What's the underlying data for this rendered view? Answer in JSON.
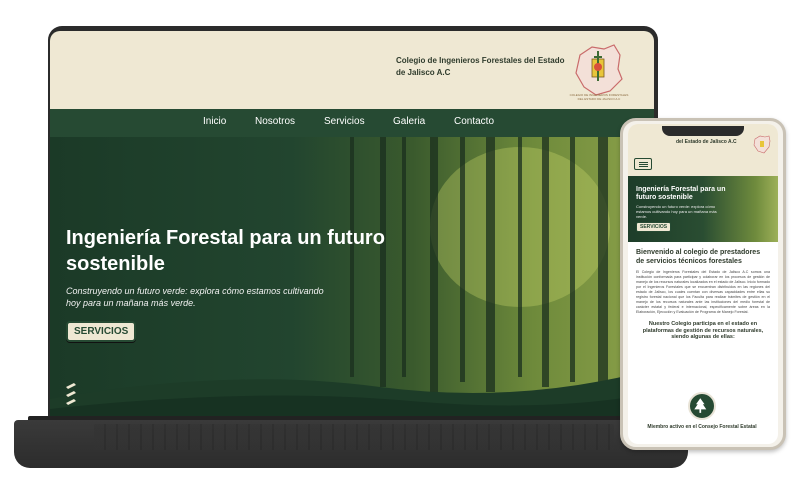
{
  "site": {
    "org_name": "Colegio de Ingenieros Forestales del Estado de Jalisco A.C",
    "logo_caption": "COLEGIO DE INGENIEROS FORESTALES DEL ESTADO DE JALISCO A.C"
  },
  "nav": {
    "items": [
      "Inicio",
      "Nosotros",
      "Servicios",
      "Galeria",
      "Contacto"
    ]
  },
  "hero": {
    "title": "Ingeniería Forestal para un futuro sostenible",
    "subtitle": "Construyendo un futuro verde: explora cómo estamos cultivando hoy para un mañana más verde.",
    "button": "SERVICIOS"
  },
  "mobile": {
    "header_title": "del Estado de Jalisco A.C",
    "welcome": "Bienvenido al colegio de prestadores de servicios técnicos forestales",
    "paragraph": "El Colegio de Ingenieros Forestales del Estado de Jalisco A.C somos una institución conformada para participar y colaborar en los procesos de gestión de manejo de los recursos naturales localizados en el estado de Jalisco. Inicio formado por el Ingenieros Forestales que se encuentran distribuidos en las regiones del estado de Jalisco, los cuales cuentan con diversas capacidades entre ellas su registro forestal nacional que los Faculta para realizar trámites de gestión en el manejo de los recursos naturales ante las instituciones del medio forestal de carácter estatal y federal e internacional, específicamente sobre áreas en la Elaboración, Ejecución y Evaluación de Programa de Manejo Forestal.",
    "highlight": "Nuestro Colegio participa en el estado en plataformas de gestión de recursos naturales, siendo algunas de ellas:",
    "badge_label": "Miembro activo en el Consejo Forestal Estatal"
  },
  "colors": {
    "cream": "#efe8d3",
    "forest_green": "#264a33",
    "text_dark": "#2f3b2c"
  },
  "icons": {
    "menu": "hamburger-menu-icon",
    "stack": "layers-icon",
    "badge": "tree-icon"
  }
}
